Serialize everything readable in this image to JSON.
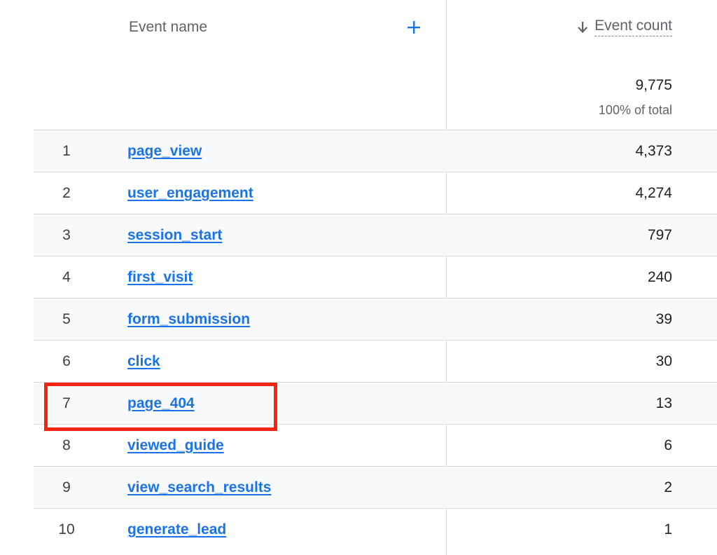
{
  "header": {
    "dimension_label": "Event name",
    "metric_label": "Event count",
    "total_value": "9,775",
    "total_pct": "100% of total"
  },
  "icons": {
    "add": "plus-icon",
    "sort": "arrow-down-icon"
  },
  "colors": {
    "link": "#1a73e8",
    "highlight": "#f5240f",
    "divider": "#dadce0"
  },
  "rows": [
    {
      "rank": "1",
      "name": "page_view",
      "value": "4,373"
    },
    {
      "rank": "2",
      "name": "user_engagement",
      "value": "4,274"
    },
    {
      "rank": "3",
      "name": "session_start",
      "value": "797"
    },
    {
      "rank": "4",
      "name": "first_visit",
      "value": "240"
    },
    {
      "rank": "5",
      "name": "form_submission",
      "value": "39"
    },
    {
      "rank": "6",
      "name": "click",
      "value": "30"
    },
    {
      "rank": "7",
      "name": "page_404",
      "value": "13"
    },
    {
      "rank": "8",
      "name": "viewed_guide",
      "value": "6"
    },
    {
      "rank": "9",
      "name": "view_search_results",
      "value": "2"
    },
    {
      "rank": "10",
      "name": "generate_lead",
      "value": "1"
    }
  ],
  "highlighted_row_rank": "7"
}
